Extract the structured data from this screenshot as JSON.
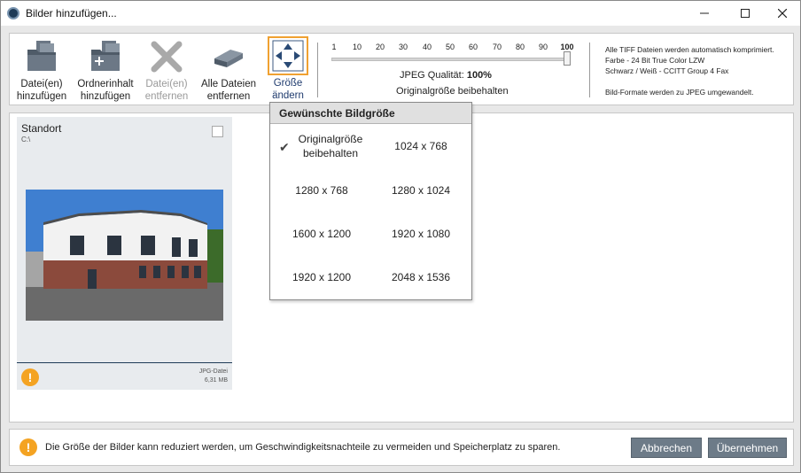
{
  "window": {
    "title": "Bilder hinzufügen...",
    "min_icon": "minimize-icon",
    "max_icon": "maximize-icon",
    "close_icon": "close-icon"
  },
  "toolbar": {
    "add_files": {
      "line1": "Datei(en)",
      "line2": "hinzufügen",
      "icon": "folder-files-icon"
    },
    "add_folder": {
      "line1": "Ordnerinhalt",
      "line2": "hinzufügen",
      "icon": "folder-plus-icon"
    },
    "remove_files": {
      "line1": "Datei(en)",
      "line2": "entfernen",
      "icon": "x-icon",
      "disabled": true
    },
    "remove_all": {
      "line1": "Alle Dateien",
      "line2": "entfernen",
      "icon": "eraser-icon"
    },
    "resize": {
      "line1": "Größe",
      "line2": "ändern",
      "icon": "resize-arrows-icon",
      "active_color": "#f0a131"
    }
  },
  "quality": {
    "scale": [
      "1",
      "10",
      "20",
      "30",
      "40",
      "50",
      "60",
      "70",
      "80",
      "90",
      "100"
    ],
    "label_prefix": "JPEG Qualität:",
    "label_value": "100%",
    "value": 100,
    "size_text": "Originalgröße beibehalten"
  },
  "info": {
    "line1": "Alle TIFF Dateien werden automatisch komprimiert.",
    "line2": "Farbe - 24 Bit True Color LZW",
    "line3": "Schwarz / Weiß - CCITT Group 4 Fax",
    "line4": "Bild-Formate werden zu JPEG umgewandelt."
  },
  "card": {
    "title": "Standort",
    "path": "C:\\",
    "file_type": "JPG-Datei",
    "file_size": "6,31 MB",
    "warn": "!"
  },
  "dropdown": {
    "header": "Gewünschte Bildgröße",
    "options": [
      {
        "line1": "Originalgröße",
        "line2": "beibehalten",
        "selected": true
      },
      {
        "line1": "1024 x 768"
      },
      {
        "line1": "1280 x 768"
      },
      {
        "line1": "1280 x 1024"
      },
      {
        "line1": "1600 x 1200"
      },
      {
        "line1": "1920 x 1080"
      },
      {
        "line1": "1920 x 1200"
      },
      {
        "line1": "2048 x 1536"
      }
    ]
  },
  "bottom": {
    "warn": "!",
    "message": "Die Größe der Bilder kann reduziert werden, um Geschwindigkeitsnachteile zu vermeiden und Speicherplatz zu sparen.",
    "cancel": "Abbrechen",
    "apply": "Übernehmen"
  },
  "colors": {
    "accent_orange": "#f4a322",
    "button_gray": "#6d7b88",
    "navy": "#1f3b57"
  }
}
